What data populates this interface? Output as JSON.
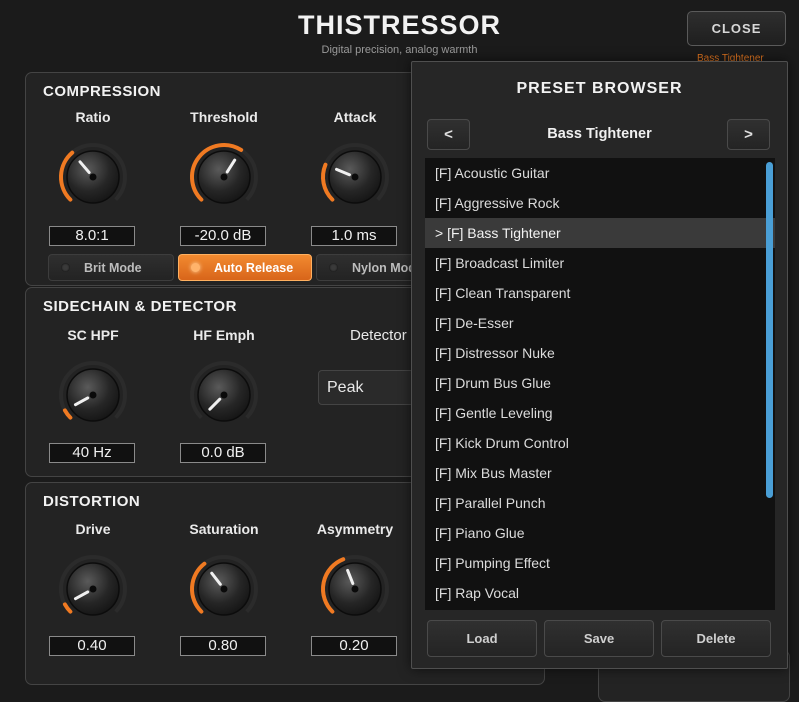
{
  "header": {
    "title": "THISTRESSOR",
    "subtitle": "Digital precision, analog warmth",
    "close_label": "CLOSE",
    "preset_indicator": "Bass Tightener"
  },
  "compression": {
    "title": "COMPRESSION",
    "knobs": [
      {
        "label": "Ratio",
        "value": "8.0:1",
        "level": 0.35
      },
      {
        "label": "Threshold",
        "value": "-20.0 dB",
        "level": 0.62
      },
      {
        "label": "Attack",
        "value": "1.0 ms",
        "level": 0.25
      }
    ],
    "toggles": [
      {
        "label": "Brit Mode",
        "on": false
      },
      {
        "label": "Auto Release",
        "on": true
      },
      {
        "label": "Nylon Mode",
        "on": false
      }
    ]
  },
  "sidechain": {
    "title": "SIDECHAIN & DETECTOR",
    "knobs": [
      {
        "label": "SC HPF",
        "value": "40 Hz",
        "level": 0.06
      },
      {
        "label": "HF Emph",
        "value": "0.0 dB",
        "level": 0.0
      }
    ],
    "detector_label": "Detector",
    "detector_value": "Peak"
  },
  "distortion": {
    "title": "DISTORTION",
    "knobs": [
      {
        "label": "Drive",
        "value": "0.40",
        "level": 0.06
      },
      {
        "label": "Saturation",
        "value": "0.80",
        "level": 0.36
      },
      {
        "label": "Asymmetry",
        "value": "0.20",
        "level": 0.42
      }
    ]
  },
  "preset_browser": {
    "title": "PRESET BROWSER",
    "prev_label": "<",
    "next_label": ">",
    "current": "Bass Tightener",
    "items": [
      "[F] Acoustic Guitar",
      "[F] Aggressive Rock",
      "> [F] Bass Tightener",
      "[F] Broadcast Limiter",
      "[F] Clean Transparent",
      "[F] De-Esser",
      "[F] Distressor Nuke",
      "[F] Drum Bus Glue",
      "[F] Gentle Leveling",
      "[F] Kick Drum Control",
      "[F] Mix Bus Master",
      "[F] Parallel Punch",
      "[F] Piano Glue",
      "[F] Pumping Effect",
      "[F] Rap Vocal"
    ],
    "selected_index": 2,
    "load_label": "Load",
    "save_label": "Save",
    "delete_label": "Delete"
  },
  "colors": {
    "accent": "#f07a22",
    "scrollbar": "#4a9fd6",
    "background": "#1b1b1b"
  }
}
